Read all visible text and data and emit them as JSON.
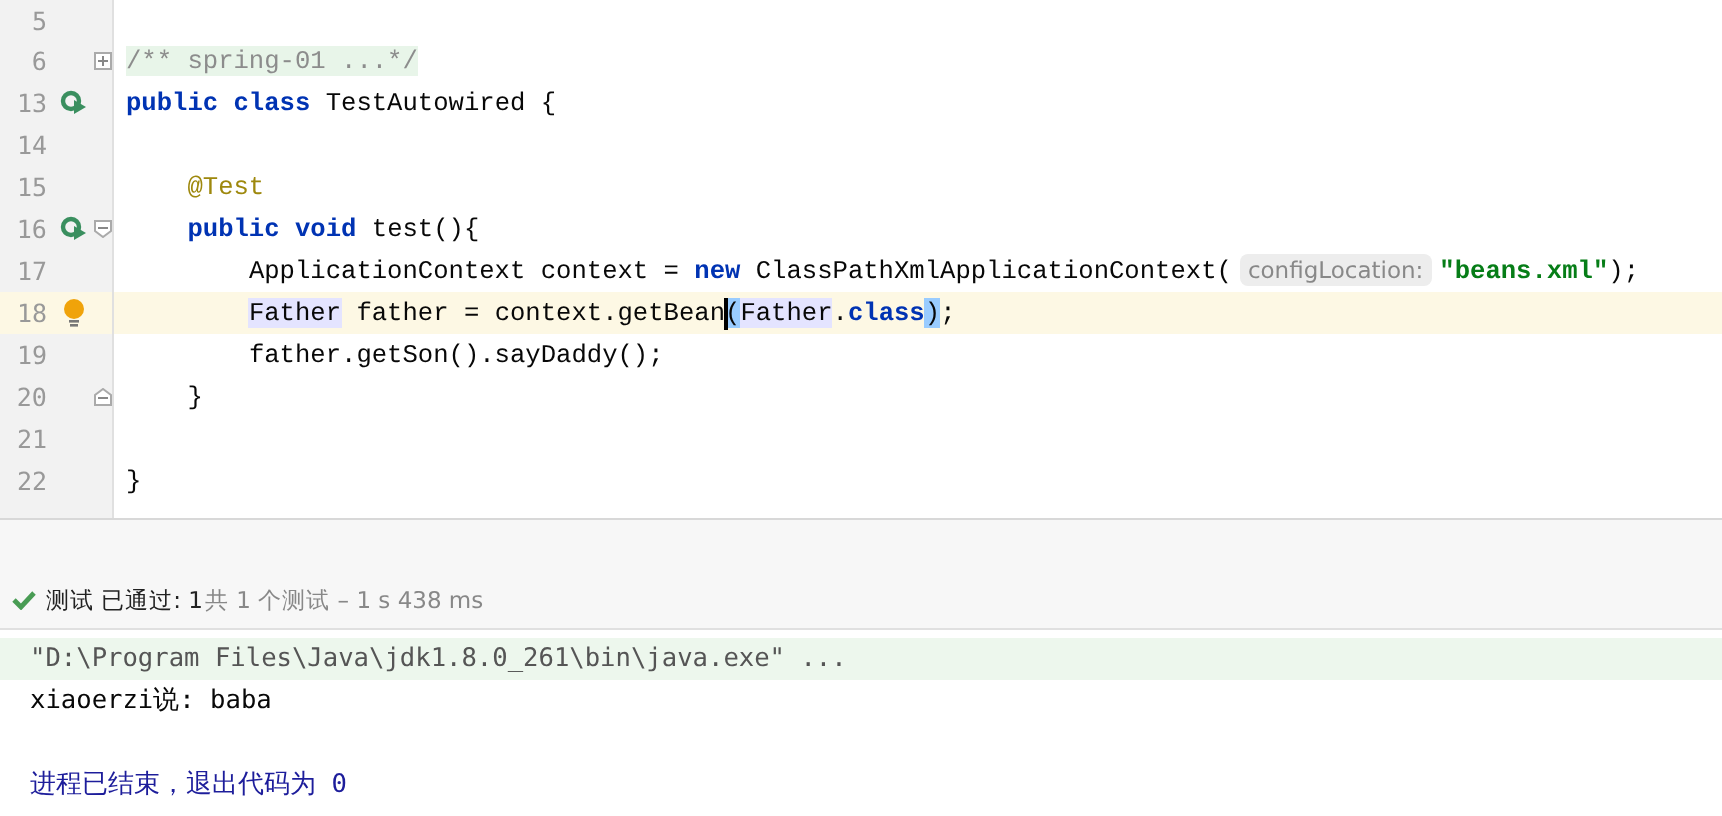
{
  "editor": {
    "lines": [
      {
        "number": "5",
        "current": false
      },
      {
        "number": "6",
        "fold_collapsed": true,
        "current": false,
        "tokens": [
          {
            "text": "/** spring-01 ...*/",
            "kind": "folded-comment"
          }
        ]
      },
      {
        "number": "13",
        "run_icon": true,
        "current": false,
        "tokens": [
          {
            "text": "public class",
            "kind": "keyword"
          },
          {
            "text": " TestAutowired {",
            "kind": "plain"
          }
        ]
      },
      {
        "number": "14",
        "current": false
      },
      {
        "number": "15",
        "current": false,
        "tokens": [
          {
            "text": "    @Test",
            "kind": "annotation"
          }
        ]
      },
      {
        "number": "16",
        "run_icon": true,
        "fold_start": true,
        "current": false,
        "tokens": [
          {
            "text": "    public void",
            "kind": "keyword"
          },
          {
            "text": " test(){",
            "kind": "plain"
          }
        ]
      },
      {
        "number": "17",
        "current": false,
        "tokens": [
          {
            "text": "        ApplicationContext context = ",
            "kind": "plain"
          },
          {
            "text": "new",
            "kind": "keyword"
          },
          {
            "text": " ClassPathXmlApplicationContext(",
            "kind": "plain"
          },
          {
            "text": "configLocation:",
            "kind": "hint"
          },
          {
            "text": "\"beans.xml\"",
            "kind": "string"
          },
          {
            "text": ");",
            "kind": "plain"
          }
        ]
      },
      {
        "number": "18",
        "bulb_icon": true,
        "current": true,
        "tokens": [
          {
            "text": "        Father",
            "kind": "usage"
          },
          {
            "text": " father = context.getBean",
            "kind": "plain"
          },
          {
            "text": "(",
            "kind": "brace"
          },
          {
            "text": "Father",
            "kind": "usage"
          },
          {
            "text": ".",
            "kind": "plain"
          },
          {
            "text": "class",
            "kind": "keyword"
          },
          {
            "text": ")",
            "kind": "brace"
          },
          {
            "text": ";",
            "kind": "plain"
          }
        ]
      },
      {
        "number": "19",
        "current": false,
        "tokens": [
          {
            "text": "        father.getSon().sayDaddy();",
            "kind": "plain"
          }
        ]
      },
      {
        "number": "20",
        "fold_end": true,
        "current": false,
        "tokens": [
          {
            "text": "    }",
            "kind": "plain"
          }
        ]
      },
      {
        "number": "21",
        "current": false
      },
      {
        "number": "22",
        "current": false,
        "tokens": [
          {
            "text": "}",
            "kind": "plain"
          }
        ]
      }
    ]
  },
  "test_status": {
    "passed": true,
    "result": "测试 已通过: 1",
    "summary": "共 1 个测试 – 1 s 438 ms"
  },
  "console": [
    {
      "kind": "command",
      "text": "\"D:\\Program Files\\Java\\jdk1.8.0_261\\bin\\java.exe\" ..."
    },
    {
      "kind": "output",
      "text": "xiaoerzi说: baba"
    },
    {
      "kind": "exit",
      "text": "进程已结束，退出代码为 0"
    }
  ]
}
